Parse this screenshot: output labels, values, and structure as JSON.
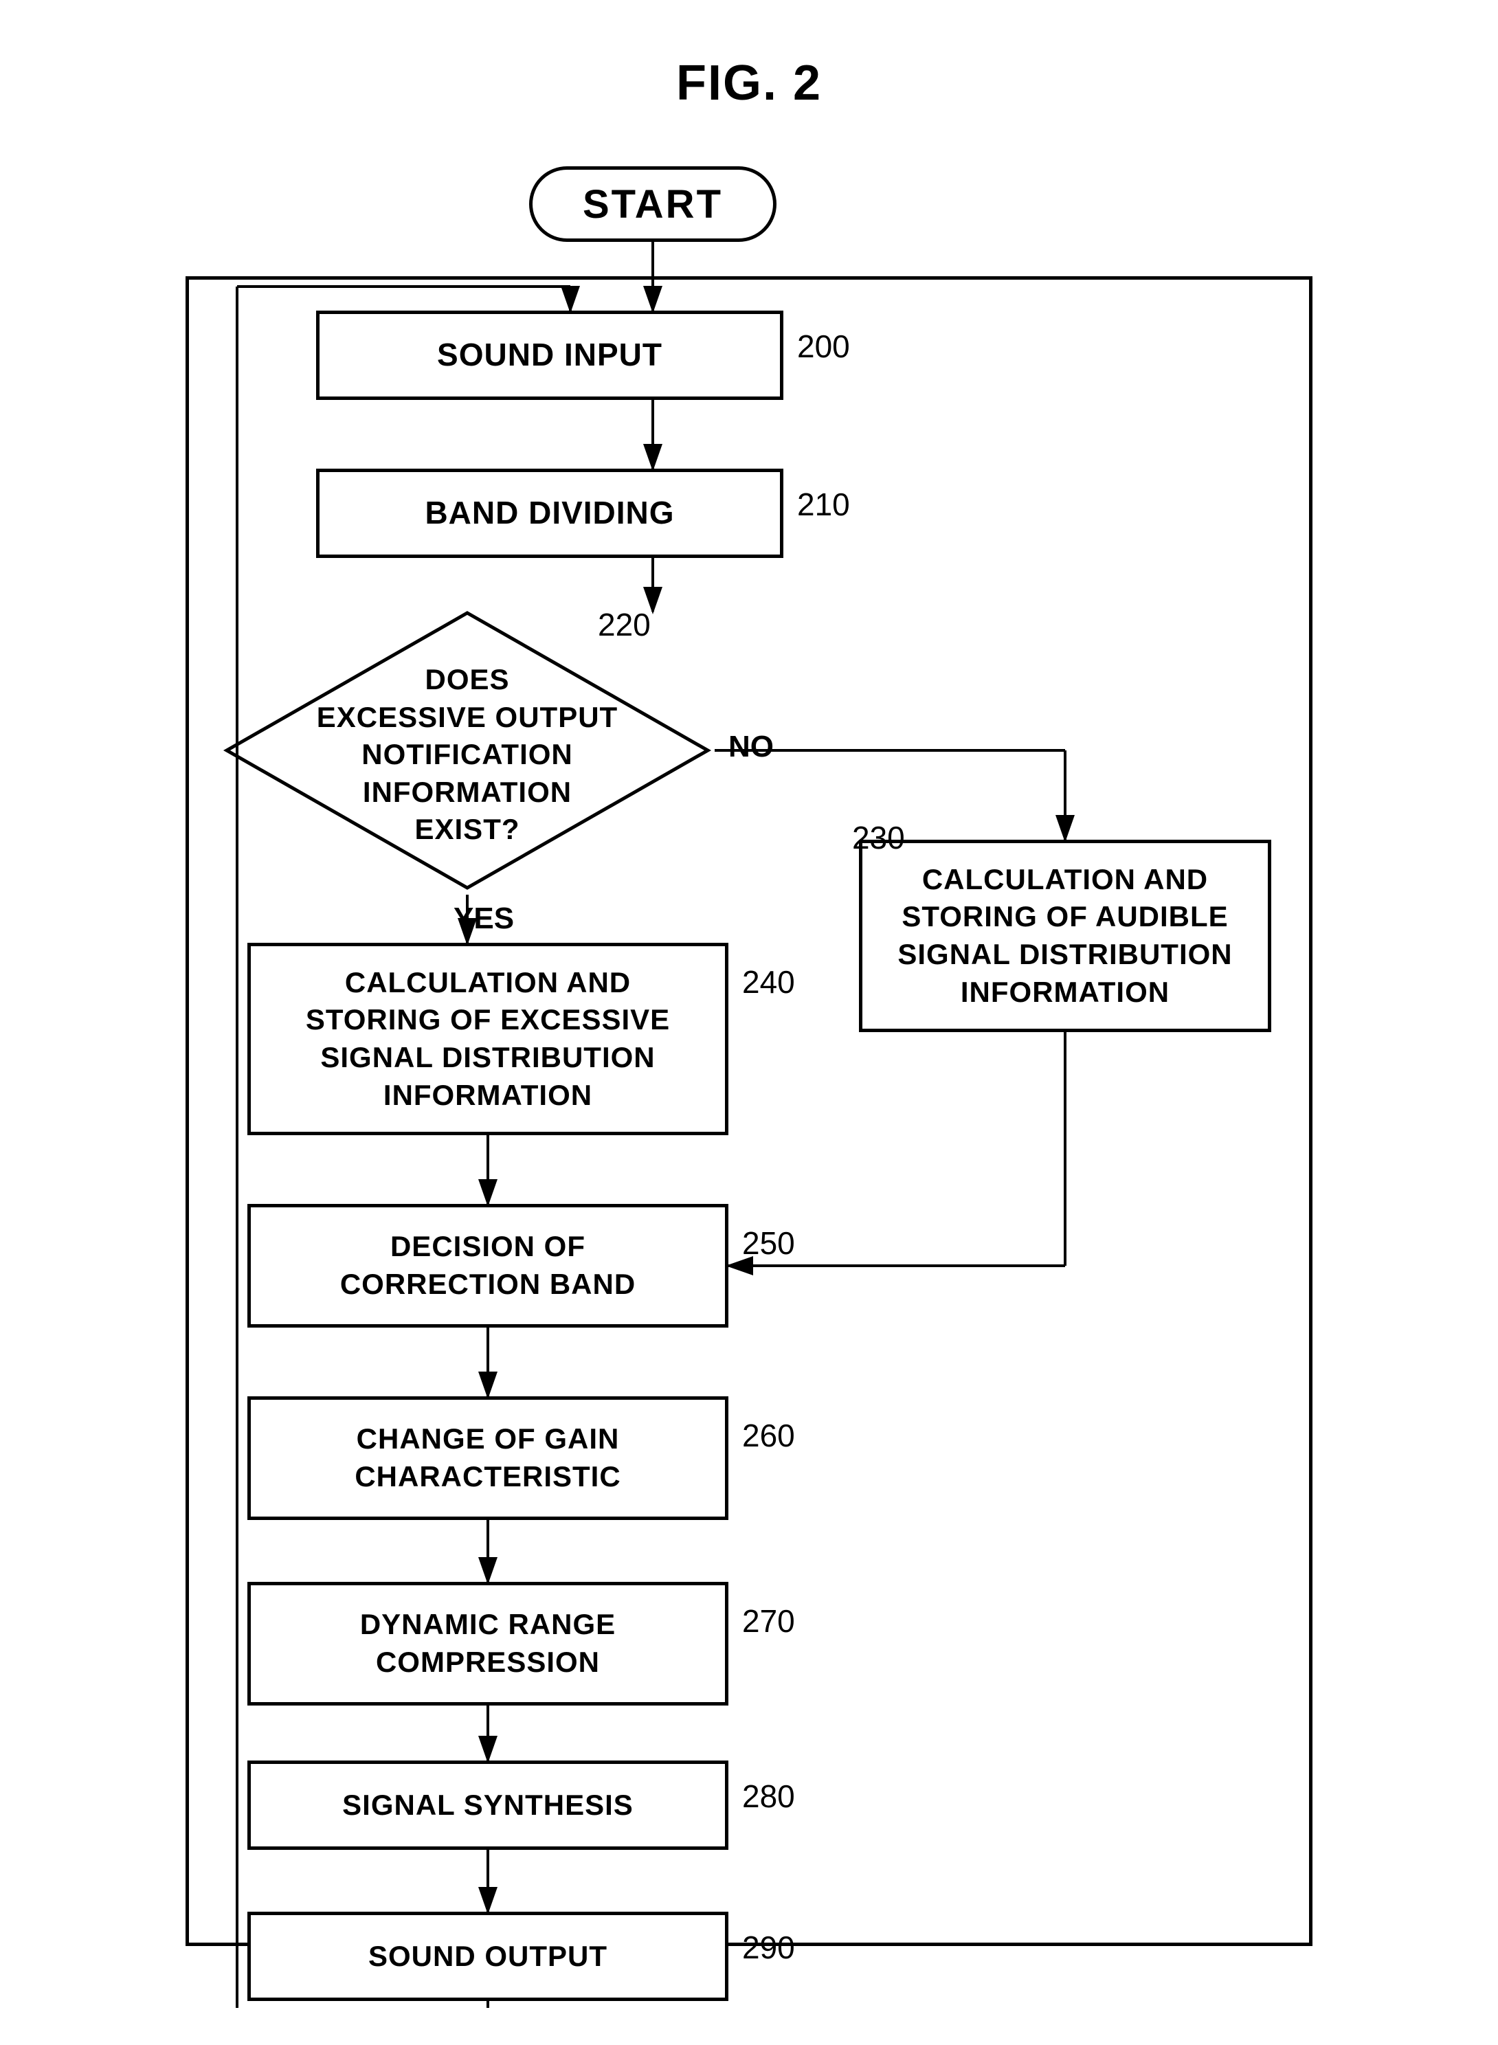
{
  "title": "FIG. 2",
  "start_label": "START",
  "steps": [
    {
      "id": "s200",
      "label": "SOUND INPUT",
      "num": "200"
    },
    {
      "id": "s210",
      "label": "BAND DIVIDING",
      "num": "210"
    },
    {
      "id": "s220_diamond",
      "label": "DOES\nEXCESSIVE OUTPUT\nNOTIFICATION INFORMATION\nEXIST?",
      "num": "220"
    },
    {
      "id": "s230",
      "label": "CALCULATION AND\nSTORING OF AUDIBLE\nSIGNAL DISTRIBUTION\nINFORMATION",
      "num": "230"
    },
    {
      "id": "s240",
      "label": "CALCULATION AND\nSTORING OF EXCESSIVE\nSIGNAL DISTRIBUTION\nINFORMATION",
      "num": "240"
    },
    {
      "id": "s250",
      "label": "DECISION OF\nCORRECTION BAND",
      "num": "250"
    },
    {
      "id": "s260",
      "label": "CHANGE OF GAIN\nCHARACTERISTIC",
      "num": "260"
    },
    {
      "id": "s270",
      "label": "DYNAMIC RANGE\nCOMPRESSION",
      "num": "270"
    },
    {
      "id": "s280",
      "label": "SIGNAL SYNTHESIS",
      "num": "280"
    },
    {
      "id": "s290",
      "label": "SOUND OUTPUT",
      "num": "290"
    }
  ],
  "labels": {
    "yes": "YES",
    "no": "NO"
  }
}
